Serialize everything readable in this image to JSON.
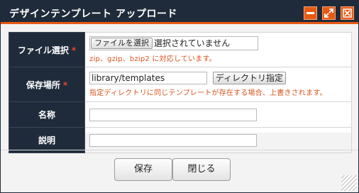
{
  "dialog": {
    "title": "デザインテンプレート アップロード",
    "controls": {
      "minimize_icon": "minimize-icon",
      "maximize_icon": "maximize-icon",
      "close_icon": "close-icon"
    }
  },
  "form": {
    "file": {
      "label": "ファイル選択",
      "required_mark": "*",
      "button_label": "ファイルを選択",
      "status": "選択されていません",
      "hint": "zip、gzip、bzip2 に対応しています。"
    },
    "location": {
      "label": "保存場所",
      "required_mark": "*",
      "value": "library/templates",
      "button_label": "ディレクトリ指定",
      "hint": "指定ディレクトリに同じテンプレートが存在する場合、上書きされます。"
    },
    "name": {
      "label": "名称",
      "value": ""
    },
    "description": {
      "label": "説明",
      "value": ""
    }
  },
  "footer": {
    "save_label": "保存",
    "close_label": "閉じる"
  },
  "colors": {
    "titlebar_bg": "#1f2b3a",
    "accent": "#e85a14",
    "required": "#e8452a",
    "hint": "#d9531e"
  }
}
